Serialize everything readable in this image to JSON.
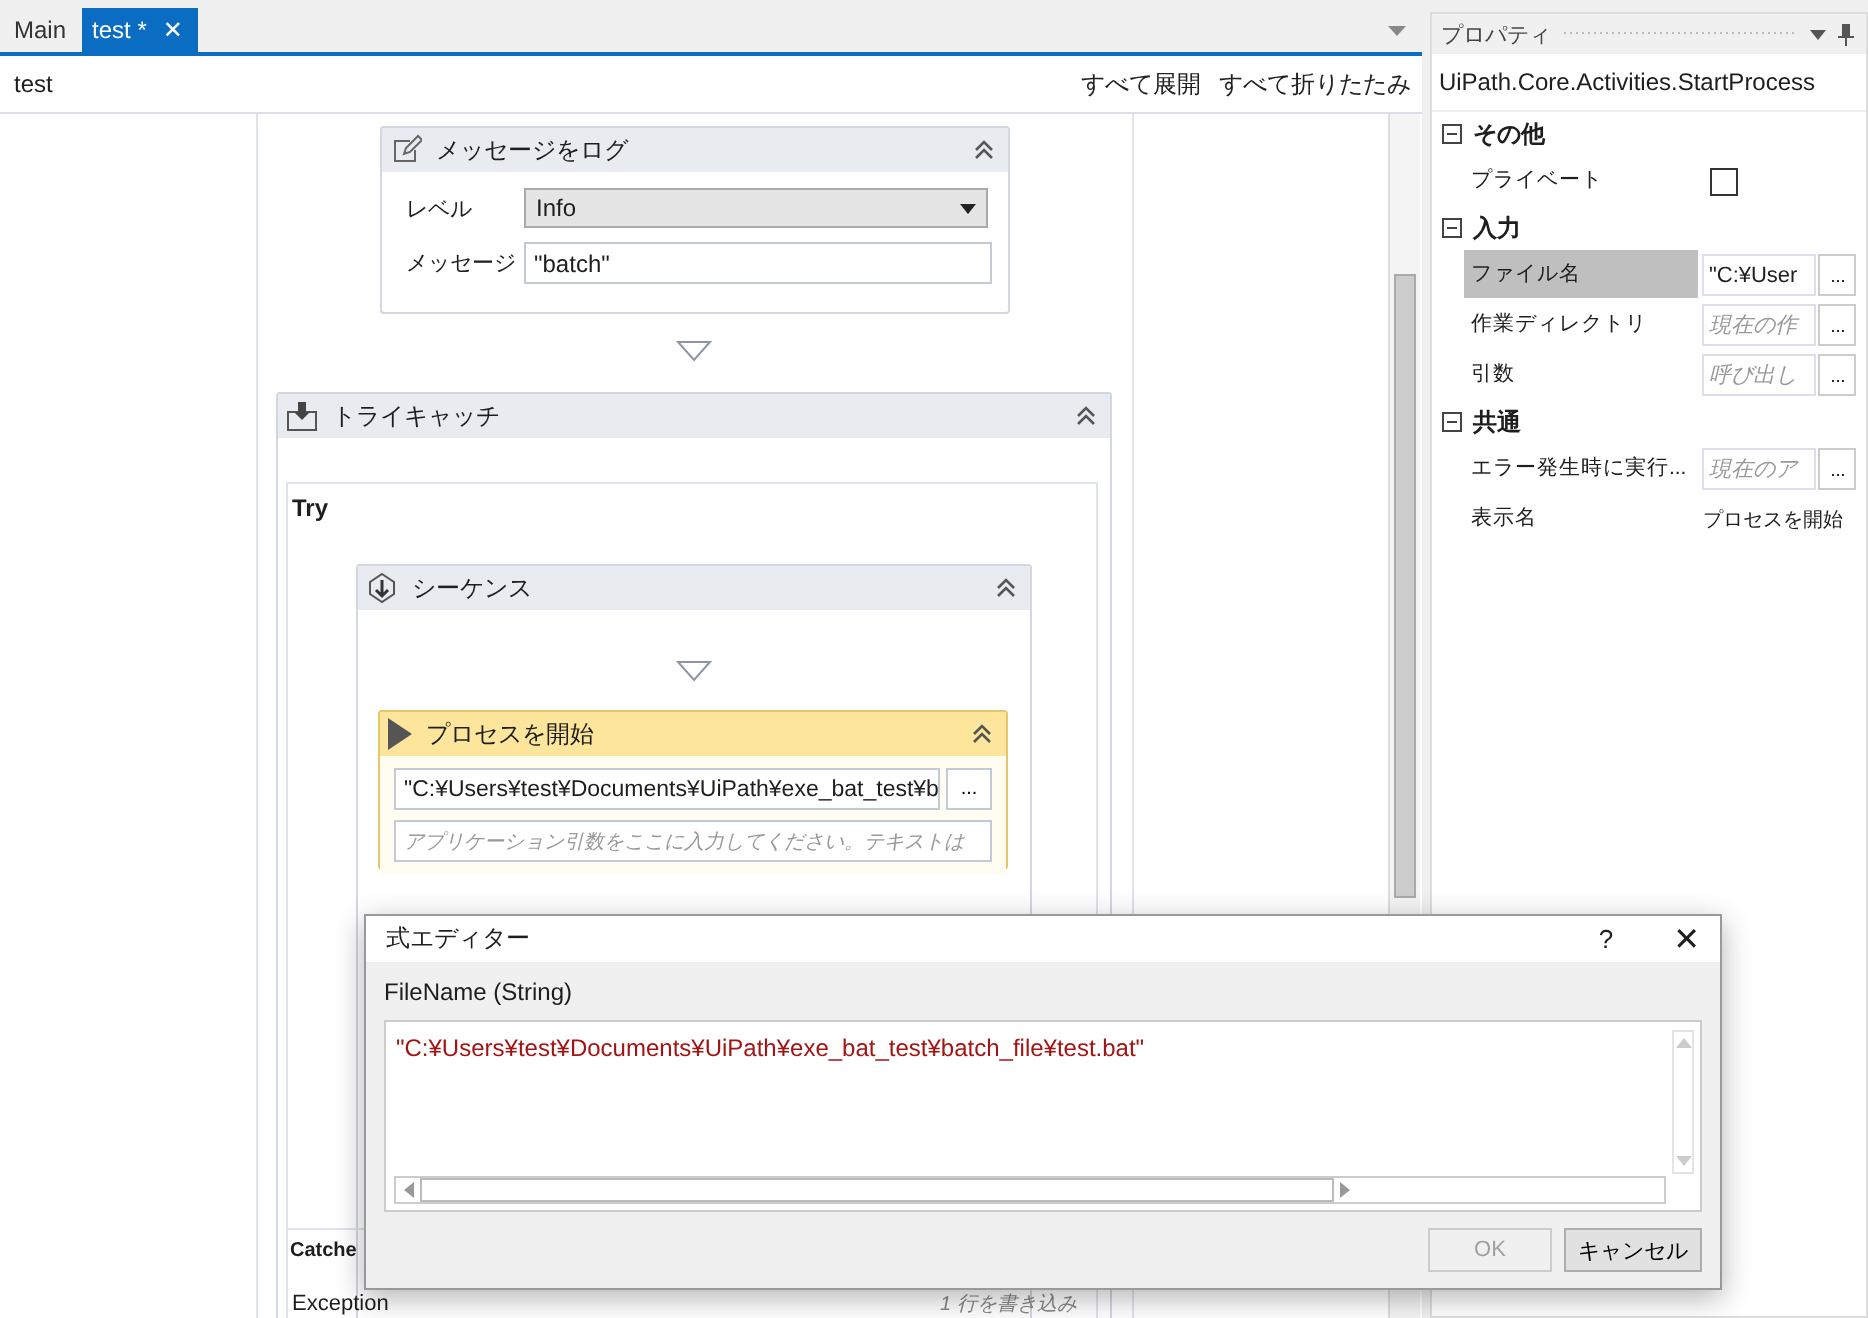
{
  "tabs": [
    {
      "label": "Main",
      "selected": false
    },
    {
      "label": "test *",
      "selected": true,
      "close": "✕"
    }
  ],
  "breadcrumb": "test",
  "toolbar_links": [
    "すべて展開",
    "すべて折りたたみ"
  ],
  "canvas": {
    "log_activity": {
      "title": "メッセージをログ",
      "fields": [
        {
          "label": "レベル",
          "kind": "dropdown",
          "value": "Info"
        },
        {
          "label": "メッセージ",
          "kind": "text",
          "value": "\"batch\""
        }
      ]
    },
    "try_catch": {
      "title": "トライキャッチ",
      "try_label": "Try",
      "catches_label": "Catche",
      "exception_label": "Exception",
      "exception_action": "1 行を書き込み",
      "sequence": {
        "title": "シーケンス",
        "start_process": {
          "title": "プロセスを開始",
          "file_value": "\"C:¥Users¥test¥Documents¥UiPath¥exe_bat_test¥b",
          "button": "...",
          "args_placeholder": "アプリケーション引数をここに入力してください。テキストは"
        }
      }
    }
  },
  "properties": {
    "title": "プロパティ",
    "type_name": "UiPath.Core.Activities.StartProcess",
    "categories": [
      {
        "name": "その他",
        "expanded": true,
        "rows": [
          {
            "label": "プライベート",
            "kind": "checkbox",
            "checked": false,
            "selected": false
          }
        ]
      },
      {
        "name": "入力",
        "expanded": true,
        "rows": [
          {
            "label": "ファイル名",
            "kind": "expression",
            "value": "\"C:¥User",
            "selected": true,
            "button": "..."
          },
          {
            "label": "作業ディレクトリ",
            "kind": "expression",
            "placeholder": "現在の作",
            "selected": false,
            "button": "..."
          },
          {
            "label": "引数",
            "kind": "expression",
            "placeholder": "呼び出し",
            "selected": false,
            "button": "..."
          }
        ]
      },
      {
        "name": "共通",
        "expanded": true,
        "rows": [
          {
            "label": "エラー発生時に実行...",
            "kind": "expression",
            "placeholder": "現在のア",
            "selected": false,
            "button": "..."
          },
          {
            "label": "表示名",
            "kind": "text",
            "value": "プロセスを開始",
            "selected": false
          }
        ]
      }
    ]
  },
  "dialog": {
    "title": "式エディター",
    "help": "?",
    "close": "✕",
    "label": "FileName (String)",
    "expression": "\"C:¥Users¥test¥Documents¥UiPath¥exe_bat_test¥batch_file¥test.bat\"",
    "buttons": [
      {
        "label": "OK",
        "disabled": true
      },
      {
        "label": "キャンセル",
        "disabled": false
      }
    ]
  }
}
